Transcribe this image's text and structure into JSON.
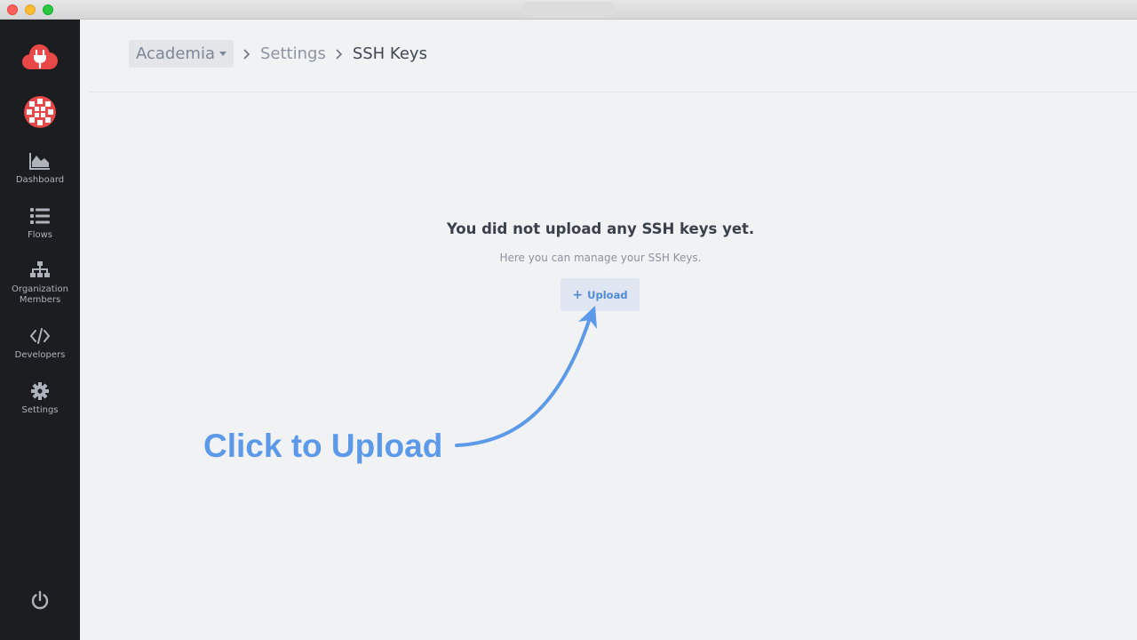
{
  "window": {
    "controls": [
      "close",
      "minimize",
      "maximize"
    ]
  },
  "sidebar": {
    "logo_icon": "cloud-plug-icon",
    "avatar_icon": "org-avatar-icon",
    "items": [
      {
        "label": "Dashboard",
        "icon": "area-chart-icon"
      },
      {
        "label": "Flows",
        "icon": "list-icon"
      },
      {
        "label": "Organization Members",
        "icon": "sitemap-icon"
      },
      {
        "label": "Developers",
        "icon": "code-icon"
      },
      {
        "label": "Settings",
        "icon": "gear-icon"
      }
    ],
    "power_icon": "power-icon"
  },
  "breadcrumb": {
    "org": "Academia",
    "settings": "Settings",
    "current": "SSH Keys"
  },
  "empty_state": {
    "title": "You did not upload any SSH keys yet.",
    "subtitle": "Here you can manage your SSH Keys.",
    "button_icon": "+",
    "button_label": "Upload"
  },
  "annotation": {
    "text": "Click to Upload"
  },
  "colors": {
    "brand": "#e84848",
    "sidebar_bg": "#1b1d20",
    "accent_blue": "#5c9ae9",
    "button_bg": "#dfe6f1"
  }
}
